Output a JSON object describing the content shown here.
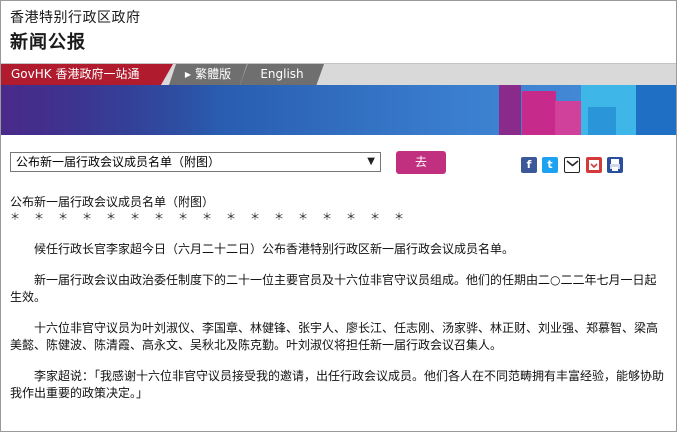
{
  "header": {
    "gov_name": "香港特别行政区政府",
    "section": "新闻公报"
  },
  "nav": {
    "govhk": "GovHK 香港政府一站通",
    "traditional": "繁體版",
    "english": "English"
  },
  "toolbar": {
    "select_value": "公布新一届行政会议成员名单（附图）",
    "go_label": "去",
    "share_icons": [
      "facebook-icon",
      "twitter-icon",
      "email-icon",
      "bookmark-icon",
      "print-icon"
    ]
  },
  "article": {
    "title": "公布新一届行政会议成员名单（附图）",
    "stars": "＊　＊　＊　＊　＊　＊　＊　＊　＊　＊　＊　＊　＊　＊　＊　＊　＊",
    "paragraphs": [
      "候任行政长官李家超今日（六月二十二日）公布香港特别行政区新一届行政会议成员名单。",
      "新一届行政会议由政治委任制度下的二十一位主要官员及十六位非官守议员组成。他们的任期由二○二二年七月一日起生效。",
      "十六位非官守议员为叶刘淑仪、李国章、林健锋、张宇人、廖长江、任志刚、汤家骅、林正财、刘业强、郑慕智、梁高美懿、陈健波、陈清霞、高永文、吴秋北及陈克勤。叶刘淑仪将担任新一届行政会议召集人。",
      "李家超说：「我感谢十六位非官守议员接受我的邀请，出任行政会议成员。他们各人在不同范畴拥有丰富经验，能够协助我作出重要的政策决定。」"
    ]
  }
}
